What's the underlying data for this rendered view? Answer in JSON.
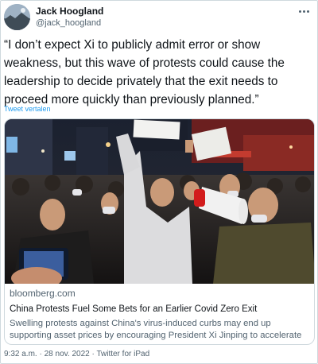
{
  "user": {
    "name": "Jack Hoogland",
    "handle": "@jack_hoogland"
  },
  "tweet": {
    "text": "“I don’t expect Xi to publicly admit error or show weakness, but this wave of protests could cause the leadership to decide privately that the exit needs to proceed more quickly than previously planned.”",
    "translate_label": "Tweet vertalen"
  },
  "card": {
    "domain": "bloomberg.com",
    "title": "China Protests Fuel Some Bets for an Earlier Covid Zero Exit",
    "description": "Swelling protests against China's virus-induced curbs may end up supporting asset prices by encouraging President Xi Jinping to accelerate the nation's exit ..."
  },
  "footer": {
    "time": "9:32 a.m.",
    "separator": "·",
    "date": "28 nov. 2022",
    "source": "Twitter for iPad"
  },
  "colors": {
    "text": "#0f1419",
    "secondary": "#536471",
    "link": "#1d9bf0",
    "border": "#cfd9de"
  },
  "icons": [
    "more-options-icon"
  ]
}
